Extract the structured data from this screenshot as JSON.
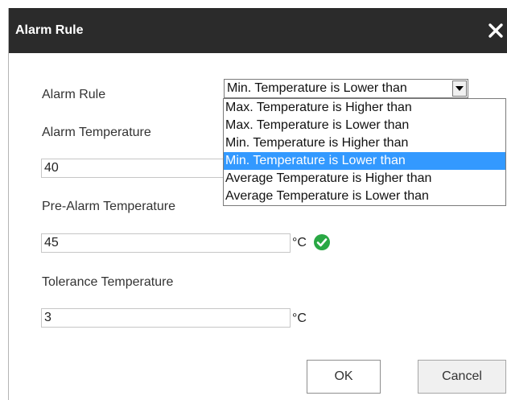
{
  "dialog": {
    "title": "Alarm Rule",
    "close_icon": "close-icon"
  },
  "form": {
    "alarm_rule": {
      "label": "Alarm Rule",
      "selected": "Min. Temperature is Lower than",
      "options": [
        "Max. Temperature is Higher than",
        "Max. Temperature is Lower than",
        "Min. Temperature is Higher than",
        "Min. Temperature is Lower than",
        "Average Temperature is Higher than",
        "Average Temperature is Lower than"
      ],
      "selected_index": 3
    },
    "alarm_temperature": {
      "label": "Alarm Temperature",
      "value": "40"
    },
    "pre_alarm_temperature": {
      "label": "Pre-Alarm Temperature",
      "value": "45",
      "unit": "°C",
      "status_icon": "check-circle-icon"
    },
    "tolerance_temperature": {
      "label": "Tolerance Temperature",
      "value": "3",
      "unit": "°C"
    }
  },
  "buttons": {
    "ok": "OK",
    "cancel": "Cancel"
  },
  "colors": {
    "titlebar": "#2b2b2b",
    "selected_option": "#3399ff",
    "valid_check": "#29a844"
  }
}
